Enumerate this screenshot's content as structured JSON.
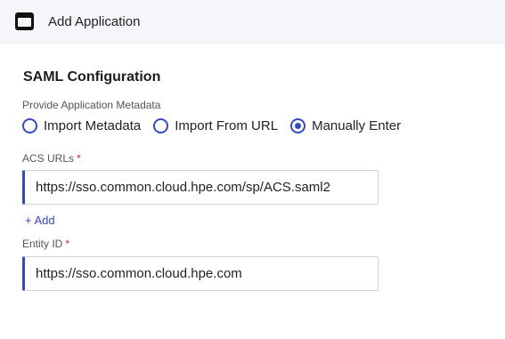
{
  "header": {
    "title": "Add Application",
    "icon": "app-window-icon"
  },
  "section": {
    "title": "SAML Configuration"
  },
  "metadata": {
    "label": "Provide Application Metadata",
    "options": [
      {
        "label": "Import Metadata",
        "checked": false
      },
      {
        "label": "Import From URL",
        "checked": false
      },
      {
        "label": "Manually Enter",
        "checked": true
      }
    ]
  },
  "acs": {
    "label": "ACS URLs",
    "required_mark": "*",
    "value": "https://sso.common.cloud.hpe.com/sp/ACS.saml2",
    "add_label": "+ Add"
  },
  "entity": {
    "label": "Entity ID",
    "required_mark": "*",
    "value": "https://sso.common.cloud.hpe.com"
  },
  "colors": {
    "accent": "#3548c7",
    "required": "#c62828",
    "header_bg": "#f5f6fa"
  }
}
